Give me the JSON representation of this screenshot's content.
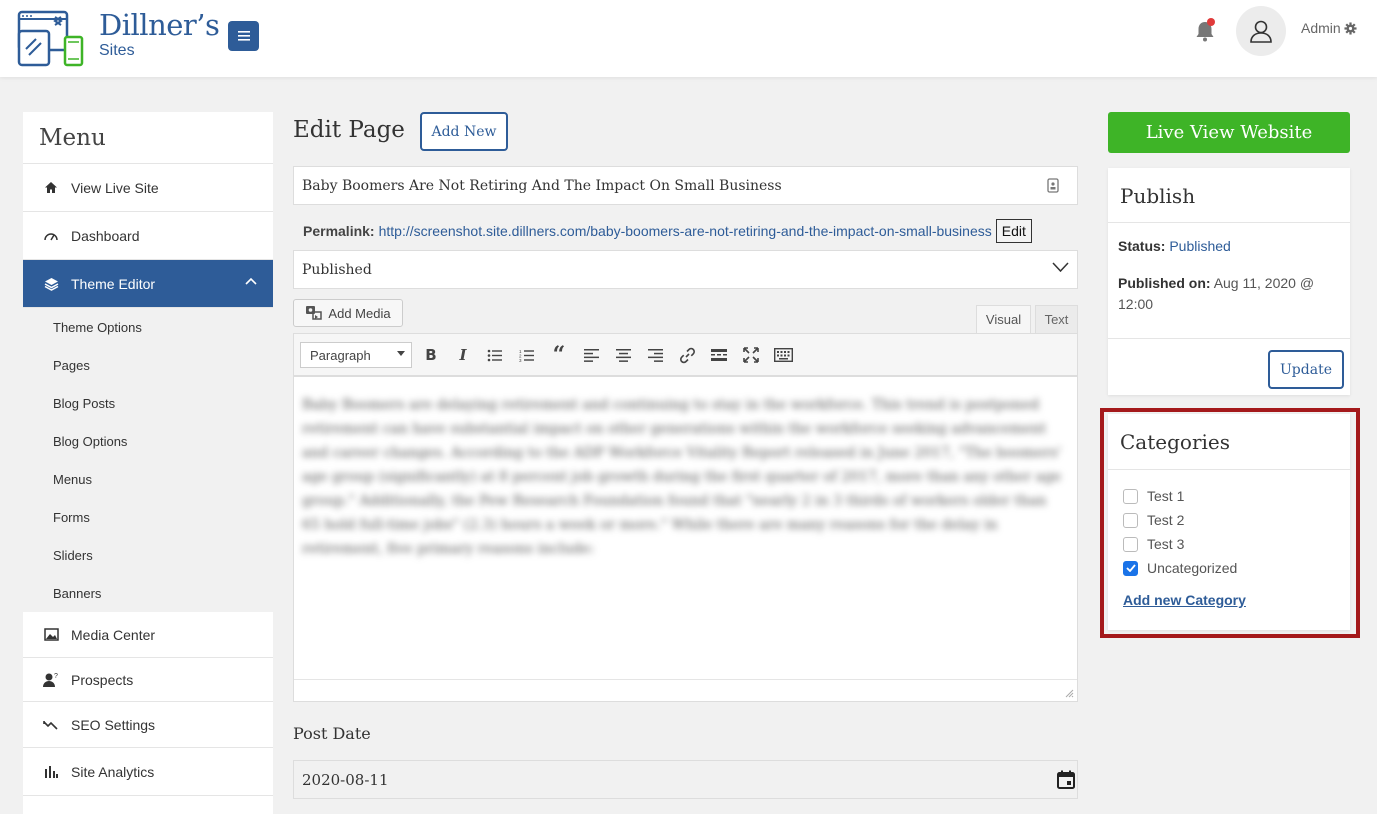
{
  "header": {
    "brand_name": "Dillner’s",
    "brand_sub": "Sites",
    "user_name": "Admin"
  },
  "sidebar": {
    "title": "Menu",
    "items_top": [
      {
        "label": "View Live Site",
        "icon": "home-icon"
      },
      {
        "label": "Dashboard",
        "icon": "gauge-icon"
      },
      {
        "label": "Theme Editor",
        "icon": "layers-icon"
      }
    ],
    "submenu": [
      "Theme Options",
      "Pages",
      "Blog Posts",
      "Blog Options",
      "Menus",
      "Forms",
      "Sliders",
      "Banners"
    ],
    "items_bottom": [
      {
        "label": "Media Center",
        "icon": "image-icon"
      },
      {
        "label": "Prospects",
        "icon": "person-question-icon"
      },
      {
        "label": "SEO Settings",
        "icon": "trend-icon"
      },
      {
        "label": "Site Analytics",
        "icon": "bar-chart-icon"
      }
    ]
  },
  "main": {
    "heading": "Edit Page",
    "add_new_label": "Add New",
    "page_title_value": "Baby Boomers Are Not Retiring And The Impact On Small Business",
    "permalink_label": "Permalink:",
    "permalink_url": "http://screenshot.site.dillners.com/baby-boomers-are-not-retiring-and-the-impact-on-small-business",
    "permalink_edit": "Edit",
    "status_value": "Published",
    "add_media_label": "Add Media",
    "tab_visual": "Visual",
    "tab_text": "Text",
    "format_select": "Paragraph",
    "editor_content": "Baby Boomers are delaying retirement and continuing to stay in the workforce. This trend is postponed retirement can have substantial impact on other generations within the workforce seeking advancement and career changes. According to the ADP Workforce Vitality Report released in June 2017, \"The boomers' age group (significantly) at 8 percent job growth during the first quarter of 2017, more than any other age group.\" Additionally, the Pew Research Foundation found that \"nearly 2 in 3 thirds of workers older than 65 hold full-time jobs\" (2.3) hours a week or more.\" While there are many reasons for the delay in retirement, five primary reasons include:",
    "post_date_label": "Post Date",
    "post_date_value": "2020-08-11"
  },
  "right": {
    "live_view_label": "Live View Website",
    "publish": {
      "title": "Publish",
      "status_label": "Status:",
      "status_value": "Published",
      "published_on_label": "Published on:",
      "published_on_value": "Aug 11, 2020 @",
      "published_on_time": "12:00",
      "update_label": "Update"
    },
    "categories": {
      "title": "Categories",
      "items": [
        {
          "label": "Test 1",
          "checked": false
        },
        {
          "label": "Test 2",
          "checked": false
        },
        {
          "label": "Test 3",
          "checked": false
        },
        {
          "label": "Uncategorized",
          "checked": true
        }
      ],
      "add_new_label": "Add new Category"
    }
  },
  "colors": {
    "brand_blue": "#2e5c98",
    "live_green": "#3eb427",
    "highlight_red": "#a4191b",
    "check_blue": "#1a73e8"
  }
}
